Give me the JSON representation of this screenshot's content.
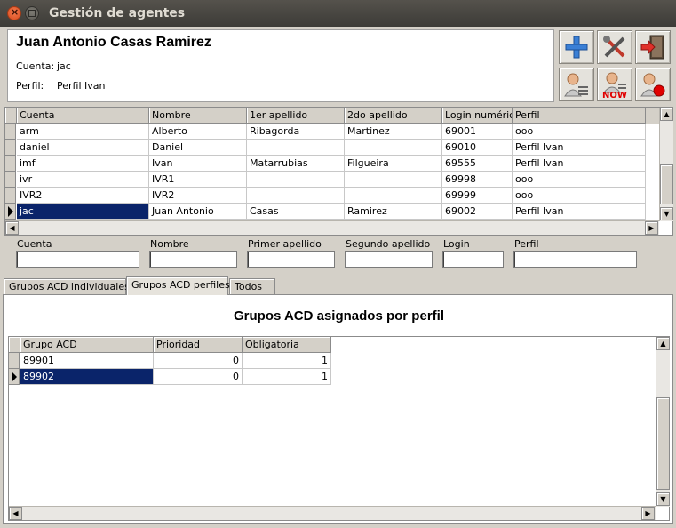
{
  "window": {
    "title": "Gestión de agentes"
  },
  "header": {
    "agent_name": "Juan Antonio Casas Ramirez",
    "cuenta_label": "Cuenta:",
    "cuenta_value": "jac",
    "perfil_label": "Perfil:",
    "perfil_value": "Perfil Ivan"
  },
  "toolbar": {
    "buttons": [
      {
        "name": "add-icon"
      },
      {
        "name": "tools-icon"
      },
      {
        "name": "exit-icon"
      },
      {
        "name": "agent-list-icon"
      },
      {
        "name": "agent-now-icon",
        "badge": "NOW"
      },
      {
        "name": "agent-record-icon"
      }
    ]
  },
  "agents_table": {
    "columns": [
      "Cuenta",
      "Nombre",
      "1er apellido",
      "2do apellido",
      "Login numéric",
      "Perfil"
    ],
    "rows": [
      {
        "cuenta": "arm",
        "nombre": "Alberto",
        "apellido1": "Ribagorda",
        "apellido2": "Martinez",
        "login": "69001",
        "perfil": "ooo"
      },
      {
        "cuenta": "daniel",
        "nombre": "Daniel",
        "apellido1": "",
        "apellido2": "",
        "login": "69010",
        "perfil": "Perfil Ivan"
      },
      {
        "cuenta": "imf",
        "nombre": "Ivan",
        "apellido1": "Matarrubias",
        "apellido2": "Filgueira",
        "login": "69555",
        "perfil": "Perfil Ivan"
      },
      {
        "cuenta": "ivr",
        "nombre": "IVR1",
        "apellido1": "",
        "apellido2": "",
        "login": "69998",
        "perfil": "ooo"
      },
      {
        "cuenta": "IVR2",
        "nombre": "IVR2",
        "apellido1": "",
        "apellido2": "",
        "login": "69999",
        "perfil": "ooo"
      },
      {
        "cuenta": "jac",
        "nombre": "Juan Antonio",
        "apellido1": "Casas",
        "apellido2": "Ramirez",
        "login": "69002",
        "perfil": "Perfil Ivan"
      }
    ]
  },
  "filters": {
    "labels": [
      "Cuenta",
      "Nombre",
      "Primer apellido",
      "Segundo apellido",
      "Login",
      "Perfil"
    ],
    "values": [
      "",
      "",
      "",
      "",
      "",
      ""
    ]
  },
  "tabs": [
    "Grupos ACD individuales",
    "Grupos ACD perfiles",
    "Todos"
  ],
  "active_tab": "Grupos ACD perfiles",
  "acd_panel": {
    "title": "Grupos ACD asignados por perfil",
    "columns": [
      "Grupo ACD",
      "Prioridad",
      "Obligatoria"
    ],
    "rows": [
      {
        "grupo": "89901",
        "prioridad": "0",
        "obligatoria": "1"
      },
      {
        "grupo": "89902",
        "prioridad": "0",
        "obligatoria": "1"
      }
    ]
  }
}
